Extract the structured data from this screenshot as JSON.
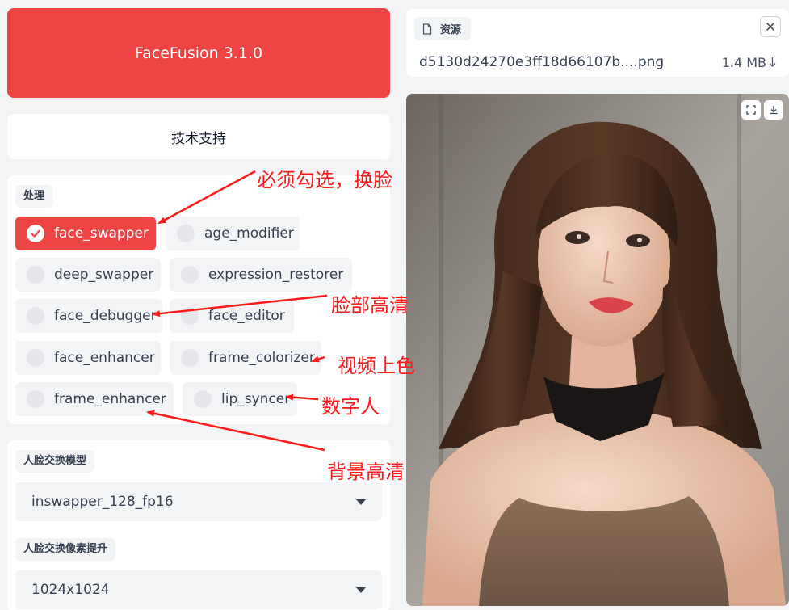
{
  "header": {
    "title": "FaceFusion 3.1.0",
    "support_label": "技术支持"
  },
  "processors": {
    "label": "处理",
    "items": [
      {
        "label": "face_swapper",
        "selected": true
      },
      {
        "label": "age_modifier",
        "selected": false
      },
      {
        "label": "deep_swapper",
        "selected": false
      },
      {
        "label": "expression_restorer",
        "selected": false
      },
      {
        "label": "face_debugger",
        "selected": false
      },
      {
        "label": "face_editor",
        "selected": false
      },
      {
        "label": "face_enhancer",
        "selected": false
      },
      {
        "label": "frame_colorizer",
        "selected": false
      },
      {
        "label": "frame_enhancer",
        "selected": false
      },
      {
        "label": "lip_syncer",
        "selected": false
      }
    ]
  },
  "face_swapper_model": {
    "label": "人脸交换模型",
    "value": "inswapper_128_fp16"
  },
  "face_swapper_pixel_boost": {
    "label": "人脸交换像素提升",
    "value": "1024x1024"
  },
  "source": {
    "label": "资源",
    "file_name": "d5130d24270e3ff18d66107b....png",
    "file_size": "1.4 MB"
  },
  "annotations": {
    "face_swapper": "必须勾选，换脸",
    "face_enhancer": "脸部高清",
    "frame_colorizer": "视频上色",
    "lip_syncer": "数字人",
    "frame_enhancer": "背景高清"
  },
  "colors": {
    "accent": "#ef4444",
    "annotation": "#ff1a1a"
  },
  "icons": {
    "file": "file-icon",
    "close": "close-icon",
    "fullscreen": "fullscreen-icon",
    "download": "download-icon",
    "check": "check-icon",
    "caret": "chevron-down-icon"
  }
}
